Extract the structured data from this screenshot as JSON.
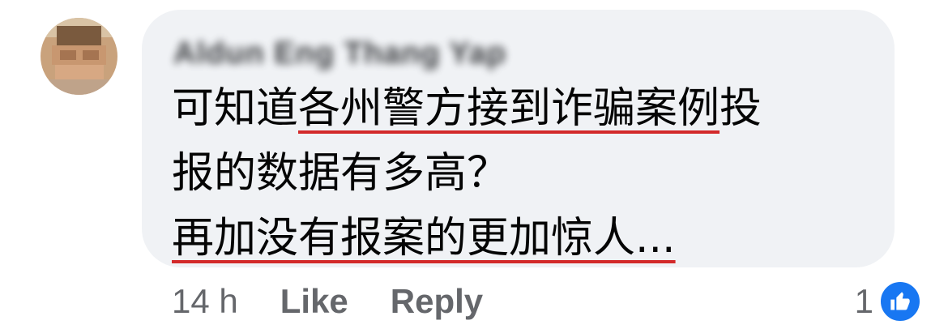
{
  "comment": {
    "author_name": "Aldun Eng Thang Yap",
    "lines": [
      {
        "pre": "可知道",
        "underlined": "各州警方接到诈骗案例",
        "post": "投"
      },
      {
        "pre": "报的数据有多高？",
        "underlined": "",
        "post": ""
      },
      {
        "pre": "",
        "underlined": "再加没有报案的更加惊人...",
        "post": ""
      }
    ],
    "underline_color": "#d32a2a"
  },
  "actions": {
    "timestamp": "14 h",
    "like_label": "Like",
    "reply_label": "Reply"
  },
  "reactions": {
    "count": "1",
    "icon": "thumbs-up-icon",
    "color": "#1877f2"
  },
  "colors": {
    "bubble": "#f0f2f5",
    "meta_text": "#65676b"
  }
}
